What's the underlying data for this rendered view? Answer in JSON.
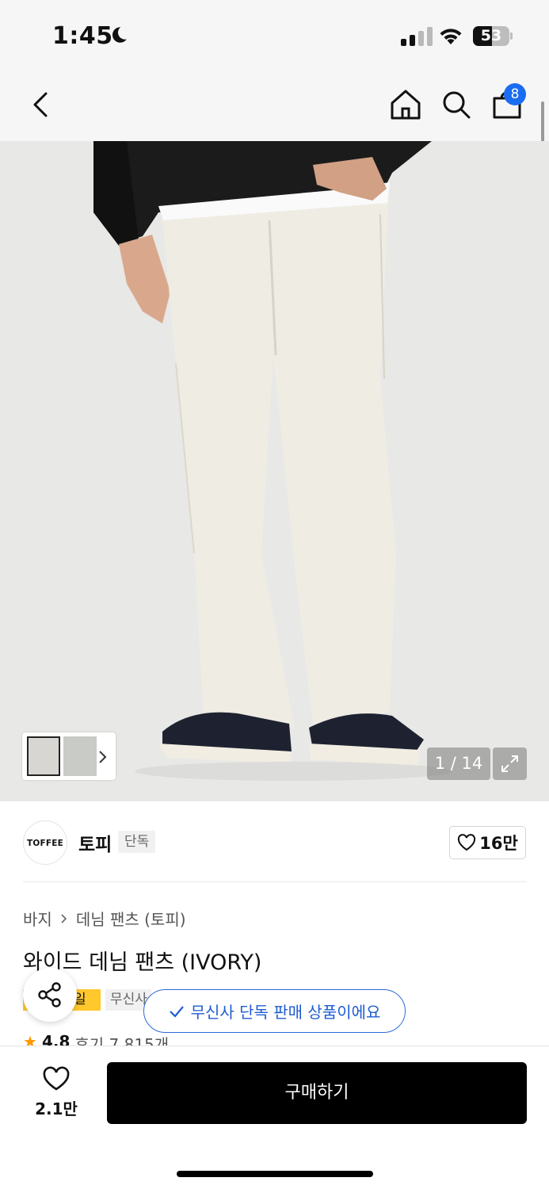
{
  "status_bar": {
    "time": "1:45",
    "battery": "53",
    "battery_level_percent": 53
  },
  "nav": {
    "cart_badge": "8"
  },
  "gallery": {
    "counter": "1 / 14"
  },
  "brand": {
    "logo_text": "TOFFEE",
    "name": "토피",
    "tag": "단독",
    "likes": "16만"
  },
  "breadcrumb": {
    "category": "바지",
    "subcategory": "데님 팬츠 (토피)"
  },
  "product": {
    "title": "와이드 데님 팬츠 (IVORY)"
  },
  "tags": {
    "sale": "일",
    "exclusive": "무신사"
  },
  "toast": {
    "text": "무신사 단독 판매 상품이에요"
  },
  "rating": {
    "score": "4.8",
    "reviews": "후기 7,815개"
  },
  "bottom_bar": {
    "wish_count": "2.1만",
    "buy_label": "구매하기"
  },
  "colors": {
    "accent_blue": "#1a6cf0",
    "sale_yellow": "#ffc82c",
    "buy_black": "#000000"
  }
}
